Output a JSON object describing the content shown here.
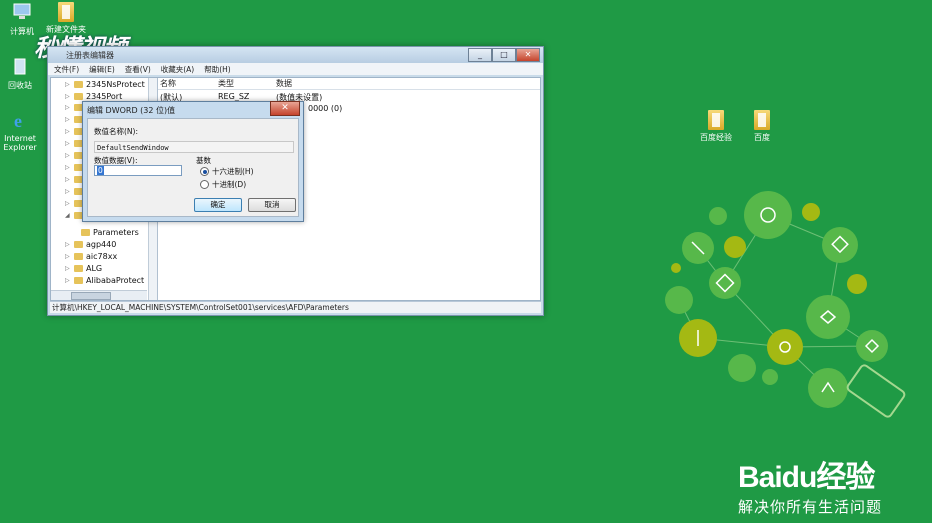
{
  "desktop": {
    "icons": [
      {
        "label": "计算机",
        "icon": "computer-icon"
      },
      {
        "label": "新建文件夹",
        "icon": "folder-icon"
      },
      {
        "label": "回收站",
        "icon": "recycle-bin-icon"
      },
      {
        "label": "Internet Explorer",
        "icon": "ie-icon"
      },
      {
        "label": "百度经验",
        "icon": "folder-icon"
      },
      {
        "label": "百度",
        "icon": "folder-icon"
      }
    ],
    "watermark": "秒懂视频"
  },
  "regedit": {
    "title": "注册表编辑器",
    "menu": [
      "文件(F)",
      "编辑(E)",
      "查看(V)",
      "收藏夹(A)",
      "帮助(H)"
    ],
    "tree_items": [
      "2345NsProtect",
      "2345Port",
      "Parameters",
      "agp440",
      "aic78xx",
      "ALG",
      "AlibabaProtect"
    ],
    "columns": {
      "name": "名称",
      "type": "类型",
      "data": "数据"
    },
    "rows": [
      {
        "name": "(默认)",
        "type": "REG_SZ",
        "data": "(数值未设置)"
      },
      {
        "name": "",
        "type": "",
        "data": "0000 (0)"
      }
    ],
    "status_path": "计算机\\HKEY_LOCAL_MACHINE\\SYSTEM\\ControlSet001\\services\\AFD\\Parameters"
  },
  "dialog": {
    "title": "编辑 DWORD (32 位)值",
    "name_label": "数值名称(N):",
    "name_value": "DefaultSendWindow",
    "data_label": "数值数据(V):",
    "data_value": "0",
    "base_label": "基数",
    "radio_hex": "十六进制(H)",
    "radio_dec": "十进制(D)",
    "ok_label": "确定",
    "cancel_label": "取消",
    "selected_base": "hex"
  },
  "branding": {
    "logo": "Baidu经验",
    "tagline": "解决你所有生活问题"
  },
  "colors": {
    "desktop_bg": "#1f9a45",
    "accent": "#3476d2"
  }
}
